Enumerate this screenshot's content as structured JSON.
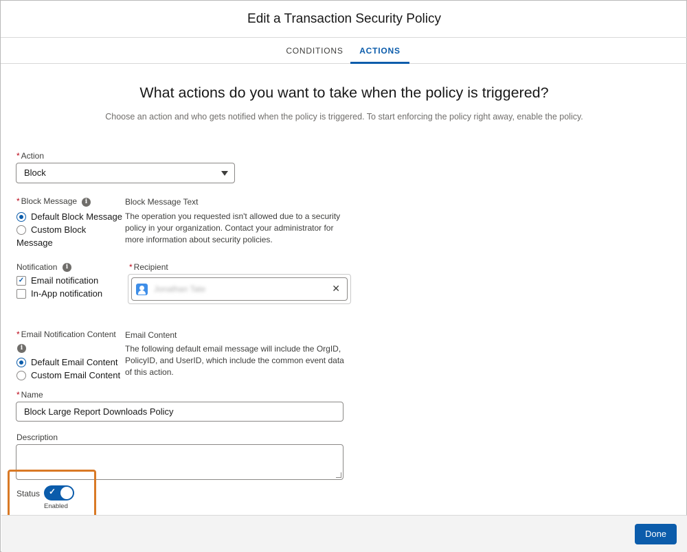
{
  "modal": {
    "title": "Edit a Transaction Security Policy"
  },
  "tabs": [
    {
      "label": "CONDITIONS",
      "active": false
    },
    {
      "label": "ACTIONS",
      "active": true
    }
  ],
  "heading": "What actions do you want to take when the policy is triggered?",
  "subheading": "Choose an action and who gets notified when the policy is triggered. To start enforcing the policy right away, enable the policy.",
  "action": {
    "label": "Action",
    "required": true,
    "value": "Block"
  },
  "block_message": {
    "label": "Block Message",
    "options": [
      "Default Block Message",
      "Custom Block",
      "Message"
    ],
    "selected": "Default Block Message",
    "text_label": "Block Message Text",
    "text_lines": [
      "The operation you requested isn't allowed due to a security",
      "policy in your organization. Contact your administrator for",
      "more information about security policies."
    ]
  },
  "notification": {
    "label": "Notification",
    "options": [
      {
        "label": "Email notification",
        "checked": true
      },
      {
        "label": "In-App notification",
        "checked": false
      }
    ]
  },
  "recipient": {
    "label": "Recipient",
    "name": "Jonathan Tate"
  },
  "email_content": {
    "label": "Email Notification Content",
    "options": [
      "Default Email Content",
      "Custom Email Content"
    ],
    "selected": "Default Email Content",
    "text_label": "Email Content",
    "text_lines": [
      "The following default email message will include the OrgID,",
      "PolicyID, and UserID, which include the common event data",
      "of this action."
    ]
  },
  "name": {
    "label": "Name",
    "value": "Block Large Report Downloads Policy"
  },
  "description": {
    "label": "Description",
    "value": ""
  },
  "status": {
    "label": "Status",
    "state_text": "Enabled",
    "enabled": true
  },
  "footer": {
    "done_label": "Done"
  },
  "colors": {
    "brand": "#0b5cab",
    "required": "#ba0517",
    "highlight": "#d97925"
  }
}
